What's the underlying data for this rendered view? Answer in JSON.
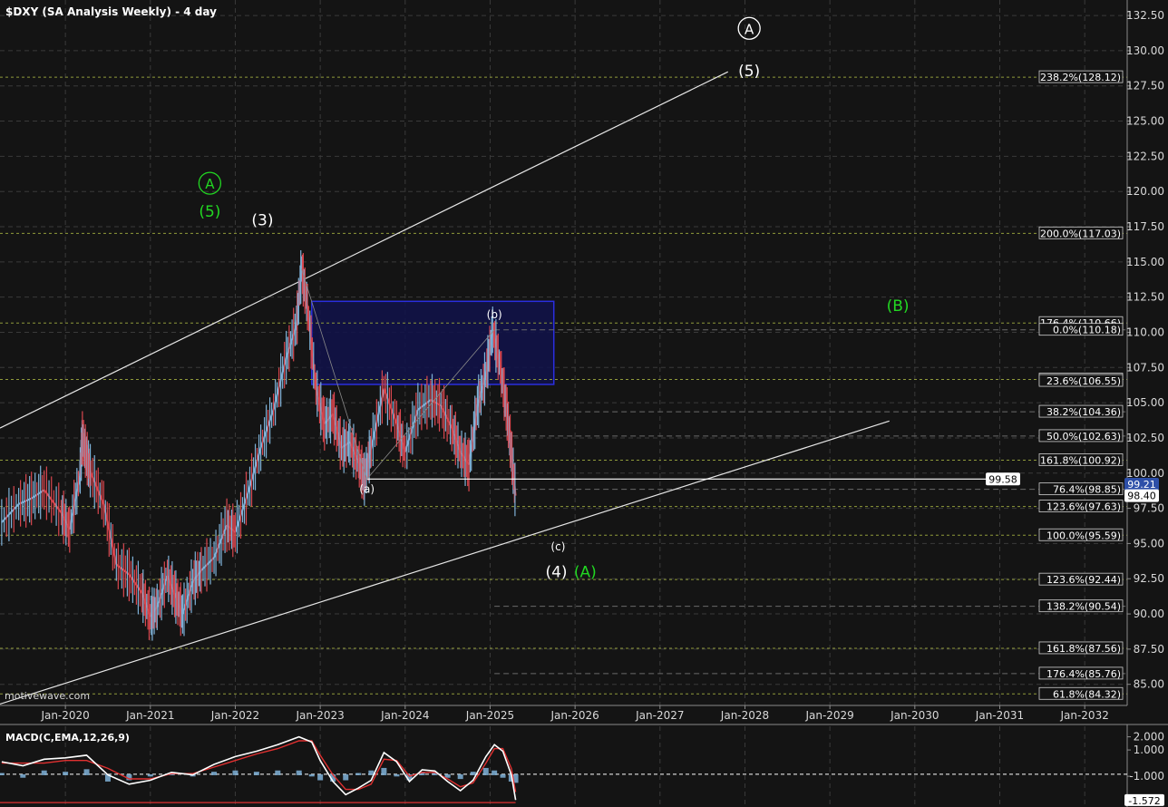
{
  "title": "$DXY (SA Analysis Weekly) - 4 day",
  "watermark": "motivewave.com",
  "colors": {
    "background": "#141414",
    "grid": "#3a3a3a",
    "candle_up": "#7fb2d8",
    "candle_down": "#d9474f",
    "channel": "#e6e6e6",
    "wave_white": "#ffffff",
    "wave_green": "#22d822",
    "fib_box_fill": "#10124a",
    "fib_box_stroke": "#2a2ee0",
    "fib_line": "#8f9a3a",
    "macd_line": "#ffffff",
    "signal_line": "#e03030",
    "histogram": "#7fb2d8"
  },
  "chart_data": {
    "type": "line",
    "x_axis": {
      "ticks": [
        "Jan-2020",
        "Jan-2021",
        "Jan-2022",
        "Jan-2023",
        "Jan-2024",
        "Jan-2025",
        "Jan-2026",
        "Jan-2027",
        "Jan-2028",
        "Jan-2029",
        "Jan-2030",
        "Jan-2031",
        "Jan-2032"
      ],
      "tick_years": [
        2020,
        2021,
        2022,
        2023,
        2024,
        2025,
        2026,
        2027,
        2028,
        2029,
        2030,
        2031,
        2032
      ],
      "xlim": [
        2019.23,
        2032.5
      ]
    },
    "y_axis": {
      "ticks": [
        "85.00",
        "87.50",
        "90.00",
        "92.50",
        "95.00",
        "97.50",
        "100.00",
        "102.50",
        "105.00",
        "107.50",
        "110.00",
        "112.50",
        "115.00",
        "117.50",
        "120.00",
        "122.50",
        "125.00",
        "127.50",
        "130.00",
        "132.50"
      ],
      "ylim": [
        83.5,
        133.6
      ]
    },
    "price_series": {
      "name": "$DXY",
      "x": [
        2019.25,
        2019.45,
        2019.6,
        2019.75,
        2019.95,
        2020.05,
        2020.17,
        2020.2,
        2020.25,
        2020.3,
        2020.45,
        2020.6,
        2020.75,
        2020.9,
        2021.0,
        2021.08,
        2021.2,
        2021.3,
        2021.38,
        2021.5,
        2021.6,
        2021.75,
        2021.9,
        2022.0,
        2022.15,
        2022.3,
        2022.45,
        2022.6,
        2022.72,
        2022.78,
        2022.85,
        2022.95,
        2023.05,
        2023.15,
        2023.25,
        2023.35,
        2023.45,
        2023.52,
        2023.6,
        2023.75,
        2023.9,
        2024.0,
        2024.15,
        2024.3,
        2024.42,
        2024.55,
        2024.65,
        2024.75,
        2024.85,
        2024.95,
        2025.03,
        2025.12,
        2025.2,
        2025.25,
        2025.3
      ],
      "values": [
        96.5,
        97.8,
        98.2,
        98.8,
        97.2,
        96.0,
        99.8,
        102.5,
        101.2,
        100.0,
        97.8,
        93.5,
        92.8,
        91.5,
        89.8,
        90.5,
        92.7,
        91.2,
        90.0,
        92.3,
        93.1,
        94.0,
        96.3,
        95.8,
        98.6,
        101.8,
        104.5,
        108.2,
        110.5,
        114.5,
        111.8,
        106.0,
        103.5,
        104.2,
        101.8,
        102.2,
        100.8,
        99.58,
        101.8,
        106.0,
        103.5,
        101.5,
        104.5,
        105.2,
        104.8,
        103.2,
        101.5,
        100.6,
        104.8,
        107.0,
        110.18,
        107.5,
        104.2,
        101.5,
        98.4
      ]
    },
    "macd": {
      "label": "MACD(C,EMA,12,26,9)",
      "y_ticks": [
        "2.000",
        "1.000",
        "-1.000"
      ],
      "ylim": [
        -3.2,
        2.8
      ],
      "zero_ref": -0.85,
      "x": [
        2019.25,
        2019.5,
        2019.75,
        2020.0,
        2020.25,
        2020.5,
        2020.75,
        2021.0,
        2021.25,
        2021.5,
        2021.75,
        2022.0,
        2022.25,
        2022.5,
        2022.75,
        2022.9,
        2023.0,
        2023.15,
        2023.3,
        2023.45,
        2023.6,
        2023.75,
        2023.9,
        2024.05,
        2024.2,
        2024.35,
        2024.5,
        2024.65,
        2024.8,
        2024.95,
        2025.05,
        2025.15,
        2025.25,
        2025.3
      ],
      "macd_values": [
        0.1,
        -0.2,
        0.3,
        0.4,
        0.6,
        -0.9,
        -1.6,
        -1.3,
        -0.7,
        -0.9,
        -0.1,
        0.5,
        0.9,
        1.4,
        2.0,
        1.6,
        0.2,
        -1.4,
        -2.4,
        -1.9,
        -1.3,
        0.8,
        0.1,
        -1.4,
        -0.5,
        -0.6,
        -1.4,
        -2.1,
        -1.3,
        0.5,
        1.4,
        0.9,
        -0.9,
        -2.8
      ],
      "signal_values": [
        0.0,
        0.0,
        0.0,
        0.2,
        0.2,
        -0.4,
        -1.2,
        -1.2,
        -0.8,
        -0.8,
        -0.3,
        0.2,
        0.7,
        1.1,
        1.7,
        1.7,
        0.6,
        -0.9,
        -2.0,
        -2.0,
        -1.6,
        0.3,
        0.2,
        -1.0,
        -0.7,
        -0.7,
        -1.2,
        -1.8,
        -1.5,
        0.0,
        1.1,
        1.1,
        -0.4,
        -2.2
      ],
      "readout": "-1.572"
    },
    "channel_lines": [
      {
        "from": [
          2019.23,
          103.2
        ],
        "to": [
          2027.8,
          128.5
        ]
      },
      {
        "from": [
          2019.23,
          83.6
        ],
        "to": [
          2029.7,
          103.7
        ]
      }
    ],
    "horizontal_levels": [
      {
        "name": "99.58",
        "value": 99.58,
        "from": 2023.55
      }
    ],
    "fib_box": {
      "x": [
        2022.9,
        2025.75
      ],
      "y": [
        106.3,
        112.2
      ]
    },
    "fib_dotted_lines": [
      128.12,
      117.03,
      110.66,
      106.65,
      100.92,
      97.63,
      95.59,
      92.44,
      87.56,
      84.32
    ],
    "fib_dashed_lines": [
      110.18,
      104.36,
      102.63,
      98.85,
      90.54,
      85.76
    ],
    "fib_labels": [
      {
        "text": "238.2%(128.12)",
        "value": 128.12
      },
      {
        "text": "200.0%(117.03)",
        "value": 117.03
      },
      {
        "text": "176.4%(110.66)",
        "value": 110.66
      },
      {
        "text": "0.0%(110.18)",
        "value": 110.18
      },
      {
        "text": "123.6%(106.65)",
        "value": 106.65
      },
      {
        "text": "23.6%(106.55)",
        "value": 106.55
      },
      {
        "text": "38.2%(104.36)",
        "value": 104.36
      },
      {
        "text": "50.0%(102.63)",
        "value": 102.63
      },
      {
        "text": "161.8%(100.92)",
        "value": 100.92
      },
      {
        "text": "76.4%(98.85)",
        "value": 98.85
      },
      {
        "text": "123.6%(97.63)",
        "value": 97.63
      },
      {
        "text": "100.0%(95.59)",
        "value": 95.59
      },
      {
        "text": "123.6%(92.44)",
        "value": 92.44
      },
      {
        "text": "138.2%(90.54)",
        "value": 90.54
      },
      {
        "text": "161.8%(87.56)",
        "value": 87.56
      },
      {
        "text": "176.4%(85.76)",
        "value": 85.76
      },
      {
        "text": "61.8%(84.32)",
        "value": 84.32
      }
    ],
    "price_tags": [
      {
        "text": "99.21",
        "value": 99.21
      },
      {
        "text": "98.40",
        "value": 98.4
      },
      {
        "text": "99.58",
        "value": 99.58
      }
    ],
    "wave_labels": [
      {
        "text": "A",
        "circled": true,
        "color": "white",
        "x": 2028.05,
        "y": 131.2
      },
      {
        "text": "(5)",
        "circled": false,
        "color": "white",
        "x": 2028.05,
        "y": 128.2
      },
      {
        "text": "A",
        "circled": true,
        "color": "green",
        "x": 2021.7,
        "y": 120.2
      },
      {
        "text": "(5)",
        "circled": false,
        "color": "green",
        "x": 2021.7,
        "y": 118.2
      },
      {
        "text": "(3)",
        "circled": false,
        "color": "white",
        "x": 2022.32,
        "y": 117.6
      },
      {
        "text": "(B)",
        "circled": false,
        "color": "green",
        "x": 2029.8,
        "y": 111.5
      },
      {
        "text": "(b)",
        "circled": false,
        "color": "white",
        "x": 2025.05,
        "y": 111.0
      },
      {
        "text": "(a)",
        "circled": false,
        "color": "white",
        "x": 2023.55,
        "y": 98.6
      },
      {
        "text": "(c)",
        "circled": false,
        "color": "white",
        "x": 2025.8,
        "y": 94.5
      },
      {
        "text": "(4)",
        "circled": false,
        "color": "white",
        "x": 2025.78,
        "y": 92.6
      },
      {
        "text": "(A)",
        "circled": false,
        "color": "green",
        "x": 2026.12,
        "y": 92.6
      }
    ]
  }
}
